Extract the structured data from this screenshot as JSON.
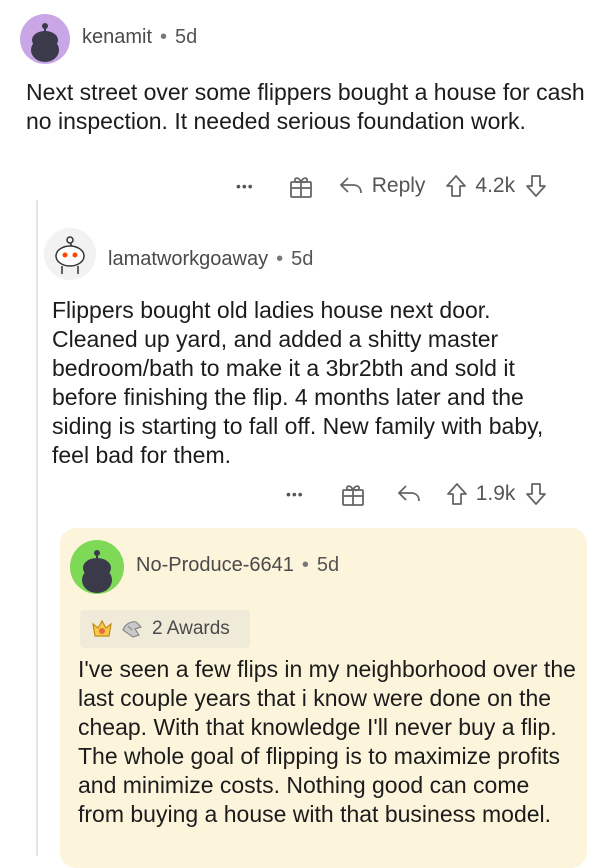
{
  "comments": [
    {
      "username": "kenamit",
      "age": "5d",
      "text": "Next street over some flippers bought a house for cash no inspection. It needed serious foundation work.",
      "actions": {
        "more": "•••",
        "reply_label": "Reply",
        "score": "4.2k"
      }
    },
    {
      "username": "lamatworkgoaway",
      "age": "5d",
      "text": "Flippers bought old ladies house next door. Cleaned up yard, and added a shitty master bedroom/bath to make it a 3br2bth and sold it before finishing the flip.  4 months later and the siding is starting to fall off.  New family with baby, feel bad for them.",
      "actions": {
        "more": "•••",
        "score": "1.9k"
      }
    },
    {
      "username": "No-Produce-6641",
      "age": "5d",
      "awards_label": "2 Awards",
      "text": "I've seen a few flips in my neighborhood over the last couple years that i know were done on the cheap. With that knowledge I'll never buy a flip. The whole goal of flipping is to maximize profits and minimize costs. Nothing good can come from buying a house with that business model."
    }
  ],
  "separator": "•",
  "colors": {
    "highlight_bg": "#fdf4dc",
    "avatar_purple": "#c9a7e6",
    "avatar_green": "#7ed957"
  }
}
